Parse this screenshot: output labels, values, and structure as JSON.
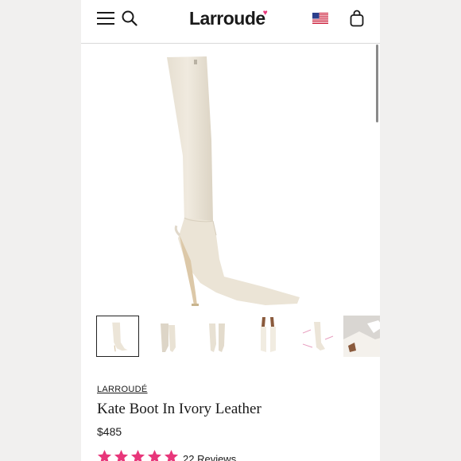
{
  "header": {
    "logo_text": "Larroude",
    "logo_mark": "♥",
    "menu_icon": "hamburger-icon",
    "search_icon": "search-icon",
    "flag_icon": "us-flag-icon",
    "bag_icon": "shopping-bag-icon"
  },
  "gallery": {
    "thumbnail_count": 6,
    "active_index": 0
  },
  "product": {
    "brand": "LARROUDÉ",
    "title": "Kate Boot In Ivory Leather",
    "price": "$485",
    "rating": 5,
    "reviews_label": "22 Reviews"
  },
  "colors": {
    "accent": "#e8367a",
    "boot_ivory": "#ece5d8",
    "gutter": "#f1f0ef",
    "text": "#1a1a1a"
  }
}
